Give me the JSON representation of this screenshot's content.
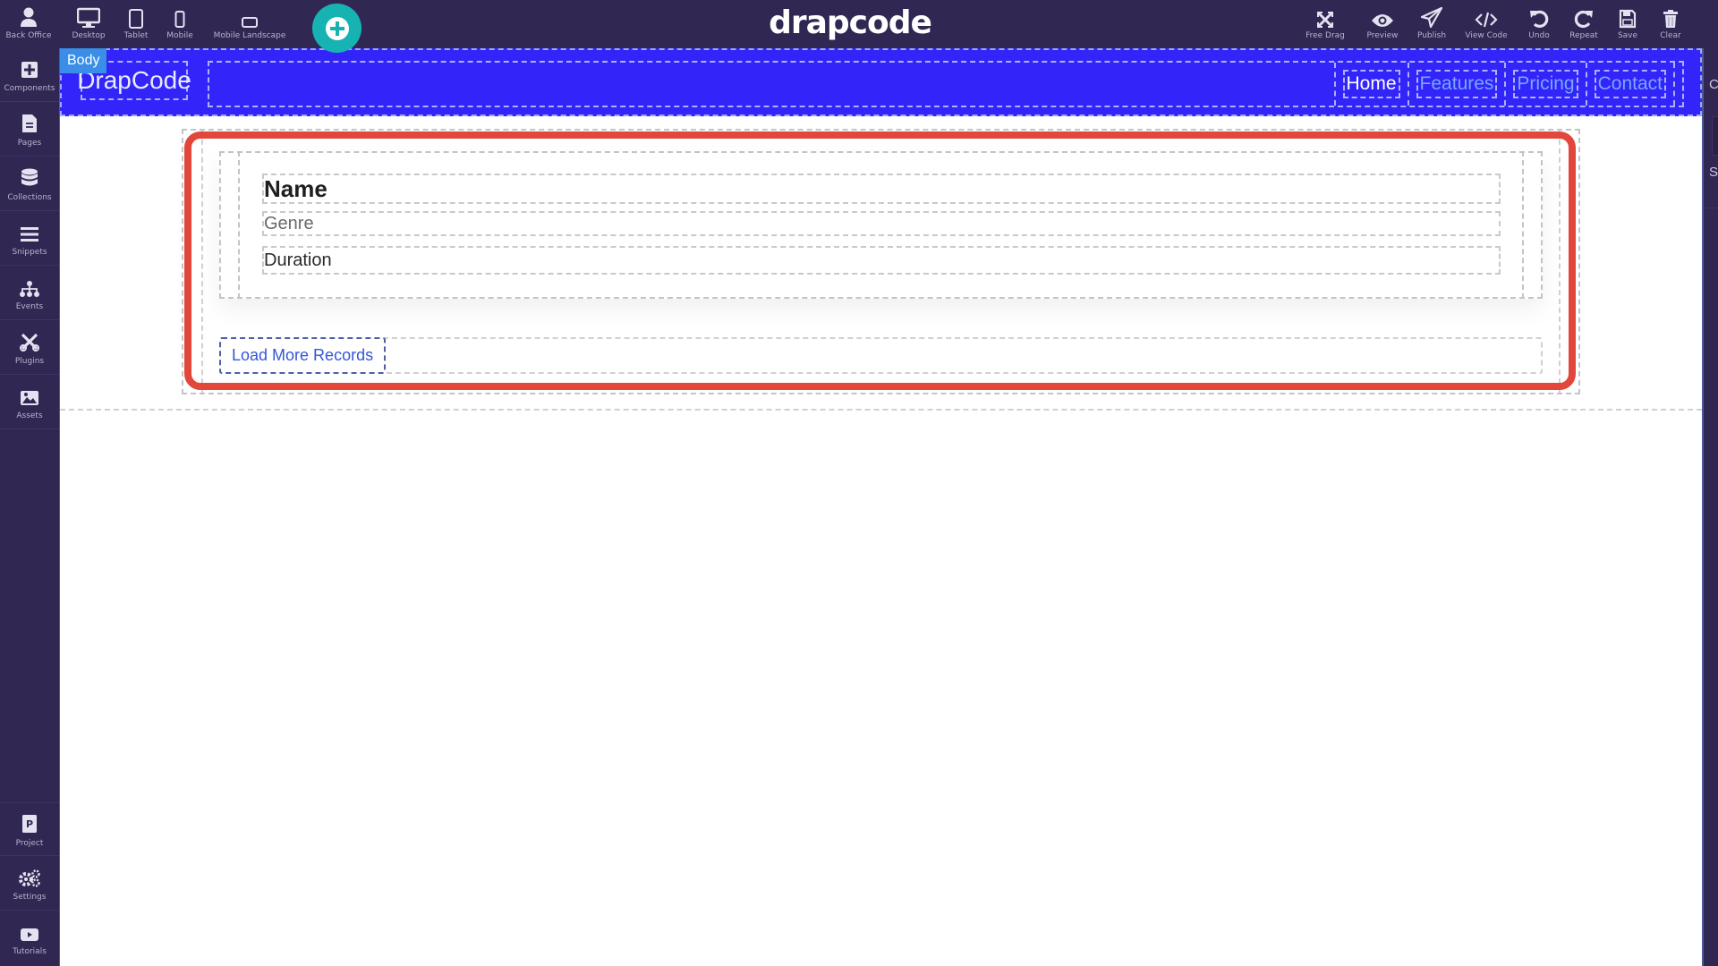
{
  "topbar": {
    "left_tools": [
      {
        "label": "Back Office",
        "icon": "user-icon"
      },
      {
        "label": "Desktop",
        "icon": "desktop-icon"
      },
      {
        "label": "Tablet",
        "icon": "tablet-icon"
      },
      {
        "label": "Mobile",
        "icon": "mobile-icon"
      },
      {
        "label": "Mobile Landscape",
        "icon": "mobile-landscape-icon"
      }
    ],
    "add_button": {
      "icon": "plus-circle-icon",
      "color": "#17b3b3"
    },
    "logo": "drapcode",
    "right_tools": [
      {
        "label": "Free Drag",
        "icon": "arrows-expand-icon"
      },
      {
        "label": "Preview",
        "icon": "eye-icon"
      },
      {
        "label": "Publish",
        "icon": "paper-plane-icon"
      },
      {
        "label": "View Code",
        "icon": "code-icon"
      },
      {
        "label": "Undo",
        "icon": "undo-icon"
      },
      {
        "label": "Repeat",
        "icon": "redo-icon"
      },
      {
        "label": "Save",
        "icon": "save-icon"
      },
      {
        "label": "Clear",
        "icon": "trash-icon"
      }
    ]
  },
  "sidebar": {
    "items": [
      {
        "label": "Components",
        "icon": "plus-square-icon"
      },
      {
        "label": "Pages",
        "icon": "file-icon"
      },
      {
        "label": "Collections",
        "icon": "database-icon"
      },
      {
        "label": "Snippets",
        "icon": "bars-icon"
      },
      {
        "label": "Events",
        "icon": "sitemap-icon"
      },
      {
        "label": "Plugins",
        "icon": "tools-icon"
      },
      {
        "label": "Assets",
        "icon": "image-icon"
      }
    ],
    "bottom_items": [
      {
        "label": "Project",
        "icon": "project-icon"
      },
      {
        "label": "Settings",
        "icon": "cogs-icon"
      },
      {
        "label": "Tutorials",
        "icon": "youtube-icon"
      }
    ]
  },
  "right_panel": {
    "letters": [
      "C",
      "S"
    ]
  },
  "canvas": {
    "body_tag": "Body",
    "header": {
      "brand": "DrapCode",
      "nav": [
        {
          "label": "Home",
          "active": true
        },
        {
          "label": "Features",
          "active": false
        },
        {
          "label": "Pricing",
          "active": false
        },
        {
          "label": "Contact",
          "active": false
        }
      ],
      "bg_color": "#3324fa"
    },
    "list": {
      "fields": {
        "name": "Name",
        "genre": "Genre",
        "duration": "Duration"
      },
      "load_more_label": "Load More Records",
      "highlight_color": "#e3463a"
    }
  }
}
